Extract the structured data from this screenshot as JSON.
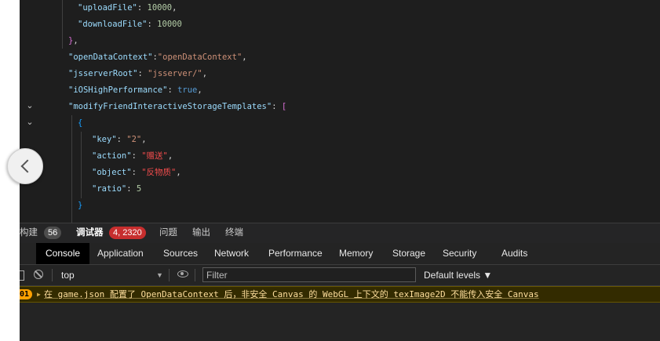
{
  "editor": {
    "lines": [
      {
        "key": "\"uploadFile\"",
        "sep": ": ",
        "value": "10000",
        "end": ","
      },
      {
        "key": "\"downloadFile\"",
        "sep": ": ",
        "value": "10000"
      },
      {
        "close": "}",
        "end": ","
      },
      {
        "key": "\"openDataContext\"",
        "sep": ":",
        "value": "\"openDataContext\"",
        "end": ","
      },
      {
        "key": "\"jsserverRoot\"",
        "sep": ": ",
        "value": "\"jsserver/\"",
        "end": ","
      },
      {
        "key": "\"iOSHighPerformance\"",
        "sep": ": ",
        "value": "true",
        "end": ","
      },
      {
        "key": "\"modifyFriendInteractiveStorageTemplates\"",
        "sep": ": ",
        "open": "["
      },
      {
        "open": "{"
      },
      {
        "key": "\"key\"",
        "sep": ": ",
        "value": "\"2\"",
        "end": ","
      },
      {
        "key": "\"action\"",
        "sep": ": ",
        "value": "\"赠送\"",
        "end": ","
      },
      {
        "key": "\"object\"",
        "sep": ": ",
        "value": "\"反物质\"",
        "end": ","
      },
      {
        "key": "\"ratio\"",
        "sep": ": ",
        "value": "5"
      },
      {
        "close": "}"
      }
    ]
  },
  "panel_tabs": {
    "build": "构建",
    "build_count": "56",
    "debugger": "调试器",
    "debugger_count": "4, 2320",
    "problems": "问题",
    "output": "输出",
    "terminal": "终端"
  },
  "devtools_tabs": [
    "Console",
    "Application",
    "Sources",
    "Network",
    "Performance",
    "Memory",
    "Storage",
    "Security",
    "Audits"
  ],
  "devtools_leading_glyph": "ᴙ",
  "console_toolbar": {
    "context": "top",
    "filter_placeholder": "Filter",
    "levels": "Default levels ▼",
    "context_arrow": "▼"
  },
  "console": {
    "count_badge": "01",
    "message": "在 game.json 配置了 OpenDataContext 后，非安全 Canvas 的 WebGL 上下文的 texImage2D 不能传入安全 Canvas"
  },
  "colors": {
    "editor_bg": "#1e1e1e",
    "json_key": "#9cdcfe",
    "json_string": "#ce9178",
    "json_number": "#b5cea8",
    "json_boolean": "#569cd6",
    "warning_bg": "#332b00",
    "warning_text": "#ffdf9e",
    "badge_red": "#c72e2e"
  },
  "icons": [
    "chevron-down-icon",
    "chevron-left-icon",
    "clear-console-icon",
    "block-icon",
    "eye-icon"
  ]
}
